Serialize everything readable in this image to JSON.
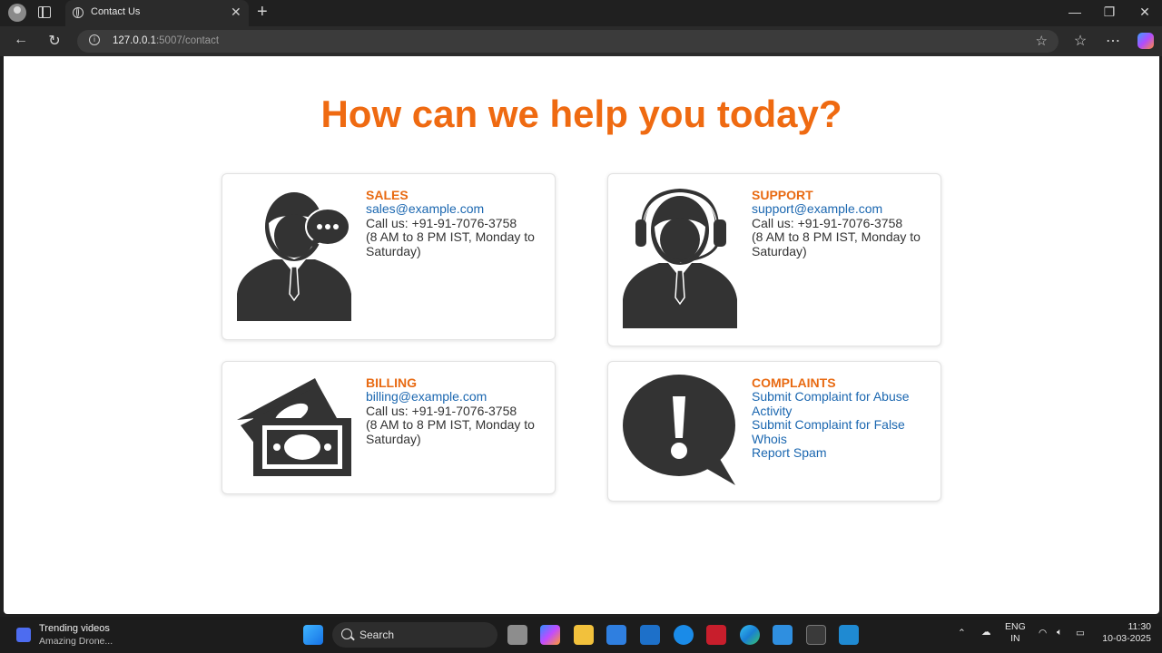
{
  "browser": {
    "tab_title": "Contact Us",
    "url_host": "127.0.0.1",
    "url_path": ":5007/contact"
  },
  "page": {
    "heading": "How can we help you today?",
    "cards": [
      {
        "icon": "sales-person-chat-icon",
        "title": "SALES",
        "email": "sales@example.com",
        "phone": "Call us: +91-91-7076-3758",
        "hours": "(8 AM to 8 PM IST, Monday to Saturday)"
      },
      {
        "icon": "support-headset-person-icon",
        "title": "SUPPORT",
        "email": "support@example.com",
        "phone": "Call us: +91-91-7076-3758",
        "hours": "(8 AM to 8 PM IST, Monday to Saturday)"
      },
      {
        "icon": "money-bills-icon",
        "title": "BILLING",
        "email": "billing@example.com",
        "phone": "Call us: +91-91-7076-3758",
        "hours": "(8 AM to 8 PM IST, Monday to Saturday)"
      },
      {
        "icon": "exclamation-speech-bubble-icon",
        "title": "COMPLAINTS",
        "links": [
          "Submit Complaint for Abuse Activity",
          "Submit Complaint for False Whois",
          "Report Spam"
        ]
      }
    ]
  },
  "taskbar": {
    "widget_title": "Trending videos",
    "widget_subtitle": "Amazing Drone...",
    "search_placeholder": "Search",
    "lang_line1": "ENG",
    "lang_line2": "IN",
    "time": "11:30",
    "date": "10-03-2025"
  },
  "colors": {
    "accent": "#ef6a11",
    "link": "#1b67b0",
    "icon_dark": "#333333"
  }
}
